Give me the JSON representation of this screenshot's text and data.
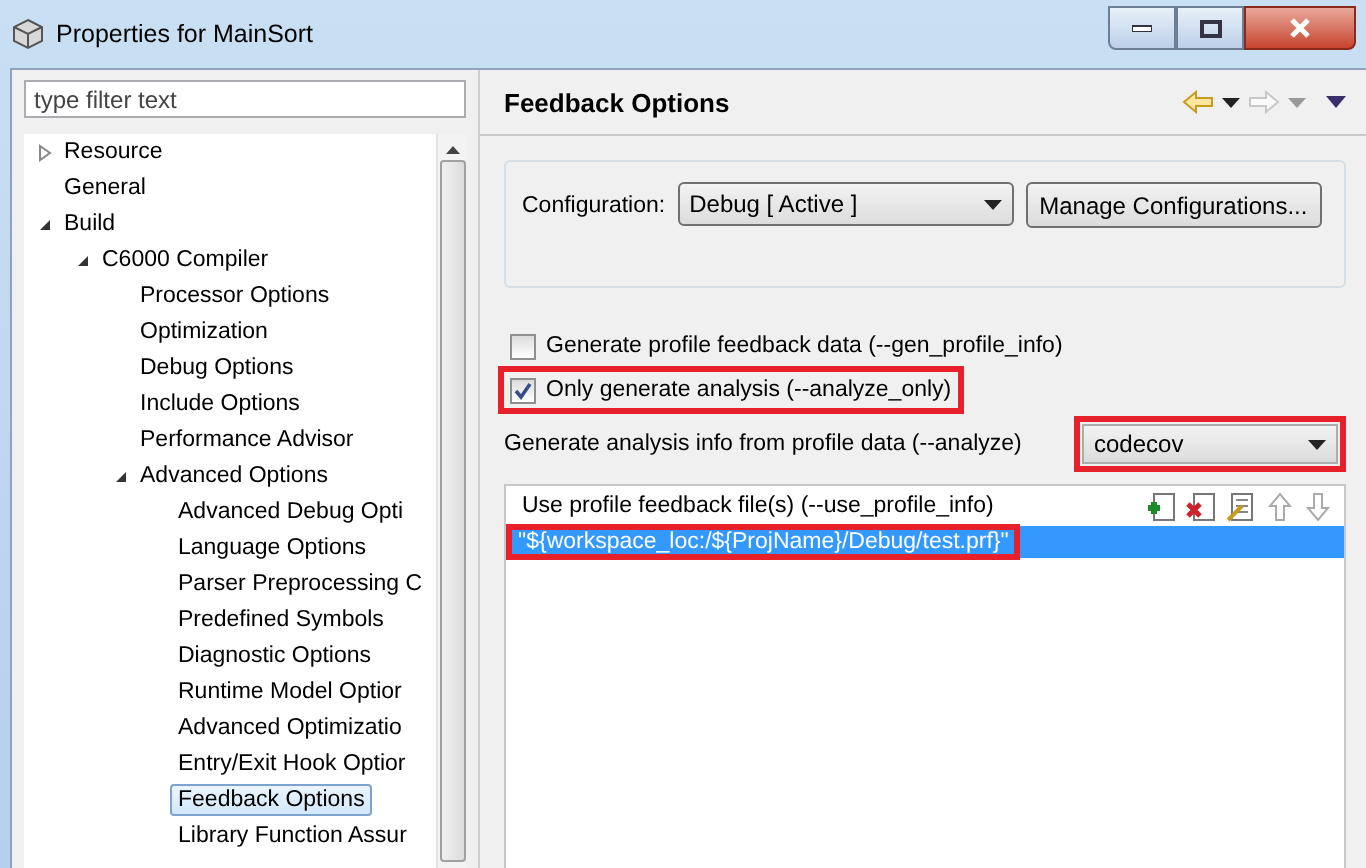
{
  "window": {
    "title": "Properties for MainSort"
  },
  "filter": {
    "placeholder": "type filter text"
  },
  "tree": [
    {
      "label": "Resource",
      "expanded": false,
      "selected": false
    },
    {
      "label": "General",
      "selected": false
    },
    {
      "label": "Build",
      "expanded": true,
      "selected": false,
      "children": [
        {
          "label": "C6000 Compiler",
          "expanded": true,
          "selected": false,
          "children": [
            {
              "label": "Processor Options",
              "selected": false
            },
            {
              "label": "Optimization",
              "selected": false
            },
            {
              "label": "Debug Options",
              "selected": false
            },
            {
              "label": "Include Options",
              "selected": false
            },
            {
              "label": "Performance Advisor",
              "selected": false
            },
            {
              "label": "Advanced Options",
              "expanded": true,
              "selected": false,
              "children": [
                {
                  "label": "Advanced Debug Opti",
                  "selected": false
                },
                {
                  "label": "Language Options",
                  "selected": false
                },
                {
                  "label": "Parser Preprocessing C",
                  "selected": false
                },
                {
                  "label": "Predefined Symbols",
                  "selected": false
                },
                {
                  "label": "Diagnostic Options",
                  "selected": false
                },
                {
                  "label": "Runtime Model Optior",
                  "selected": false
                },
                {
                  "label": "Advanced Optimizatio",
                  "selected": false
                },
                {
                  "label": "Entry/Exit Hook Optior",
                  "selected": false
                },
                {
                  "label": "Feedback Options",
                  "selected": true
                },
                {
                  "label": "Library Function Assur",
                  "selected": false
                }
              ]
            }
          ]
        }
      ]
    }
  ],
  "page": {
    "title": "Feedback Options",
    "configuration": {
      "label": "Configuration:",
      "value": "Debug  [ Active ]",
      "button": "Manage Configurations..."
    },
    "options": [
      {
        "label": "Generate profile feedback data (--gen_profile_info)",
        "checked": false,
        "highlighted": false
      },
      {
        "label": "Only generate analysis (--analyze_only)",
        "checked": true,
        "highlighted": true
      }
    ],
    "analyze": {
      "label": "Generate analysis info from profile data (--analyze)",
      "value": "codecov",
      "highlighted": true
    },
    "files": {
      "title": "Use profile feedback file(s) (--use_profile_info)",
      "items": [
        {
          "value": "\"${workspace_loc:/${ProjName}/Debug/test.prf}\"",
          "selected": true,
          "highlighted": true
        }
      ]
    }
  }
}
